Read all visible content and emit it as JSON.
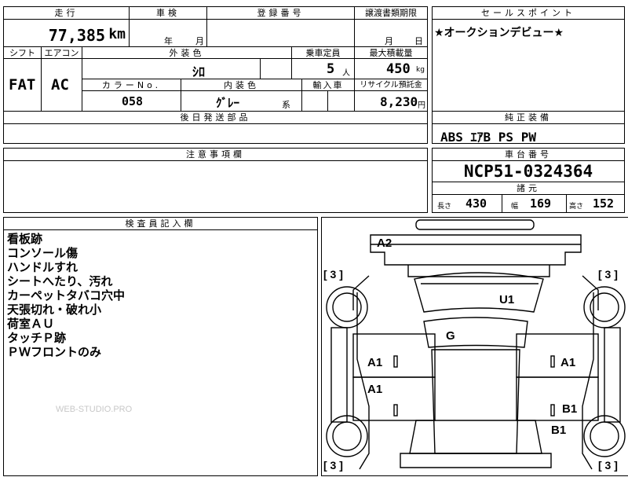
{
  "top": {
    "mileage_label": "走行",
    "mileage_value": "77,385",
    "mileage_unit": "km",
    "inspection_label": "車検",
    "inspection_year": "年",
    "inspection_month": "月",
    "reg_label": "登録番号",
    "transfer_label": "譲渡書類期限",
    "transfer_month": "月",
    "transfer_day": "日",
    "shift_label": "シフト",
    "shift_value": "FAT",
    "ac_label": "エアコン",
    "ac_value": "AC",
    "exterior_label": "外装色",
    "exterior_value": "ｼﾛ",
    "capacity_label": "乗車定員",
    "capacity_value": "5",
    "capacity_unit": "人",
    "maxload_label": "最大積載量",
    "maxload_value": "450",
    "maxload_unit": "kg",
    "colorno_label": "カラーNo.",
    "colorno_value": "058",
    "interior_label": "内装色",
    "interior_value": "ｸﾞﾚｰ",
    "interior_suffix": "系",
    "import_label": "輸入車",
    "recycle_label": "リサイクル預託金",
    "recycle_value": "8,230",
    "recycle_unit": "円",
    "later_label": "後日発送部品"
  },
  "sales": {
    "label": "セールスポイント",
    "text": "★オークションデビュー★"
  },
  "equipment": {
    "label": "純正装備",
    "text": "ABS ｴｱB PS PW"
  },
  "caution": {
    "label": "注意事項欄"
  },
  "chassis": {
    "label": "車台番号",
    "value": "NCP51-0324364",
    "spec_label": "諸元",
    "length_label": "長さ",
    "length_value": "430",
    "width_label": "幅",
    "width_value": "169",
    "height_label": "高さ",
    "height_value": "152"
  },
  "inspector": {
    "label": "検査員記入欄",
    "notes": [
      "看板跡",
      "コンソール傷",
      "ハンドルすれ",
      "シートへたり、汚れ",
      "カーペットタバコ穴中",
      "天張切れ・破れ小",
      "荷室ＡＵ",
      "タッチＰ跡",
      "ＰＷフロントのみ"
    ],
    "watermark": "WEB-STUDIO.PRO"
  },
  "diagram": {
    "marks": {
      "a2": "A2",
      "u1": "U1",
      "g": "G",
      "a1_left_top": "A1",
      "a1_left_bottom": "A1",
      "a1_right": "A1",
      "b1_right_top": "B1",
      "b1_right_bottom": "B1"
    },
    "tires": {
      "fl": "[ 3 ]",
      "fr": "[ 3 ]",
      "rl": "[ 3 ]",
      "rr": "[ 3 ]"
    }
  }
}
